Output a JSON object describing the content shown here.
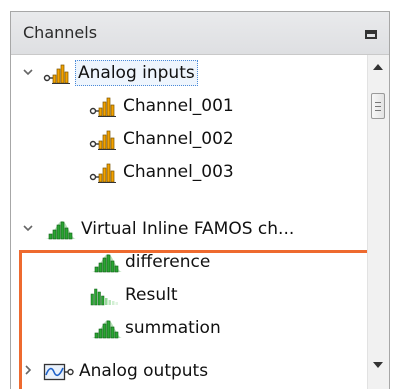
{
  "panel": {
    "title": "Channels"
  },
  "tree": {
    "analog_inputs": {
      "label": "Analog inputs",
      "expanded": true
    },
    "channels": [
      {
        "label": "Channel_001"
      },
      {
        "label": "Channel_002"
      },
      {
        "label": "Channel_003"
      }
    ],
    "virtual": {
      "label": "Virtual Inline FAMOS ch...",
      "expanded": true
    },
    "virtual_channels": [
      {
        "label": "difference",
        "icon": "green-histogram-icon"
      },
      {
        "label": "Result",
        "icon": "green-histogram-faded-icon"
      },
      {
        "label": "summation",
        "icon": "green-histogram-icon"
      }
    ],
    "analog_outputs": {
      "label": "Analog outputs",
      "expanded": false
    }
  },
  "colors": {
    "highlight": "#ee6a2f",
    "input_icon": "#f3a200",
    "virtual_icon": "#2aa532"
  }
}
